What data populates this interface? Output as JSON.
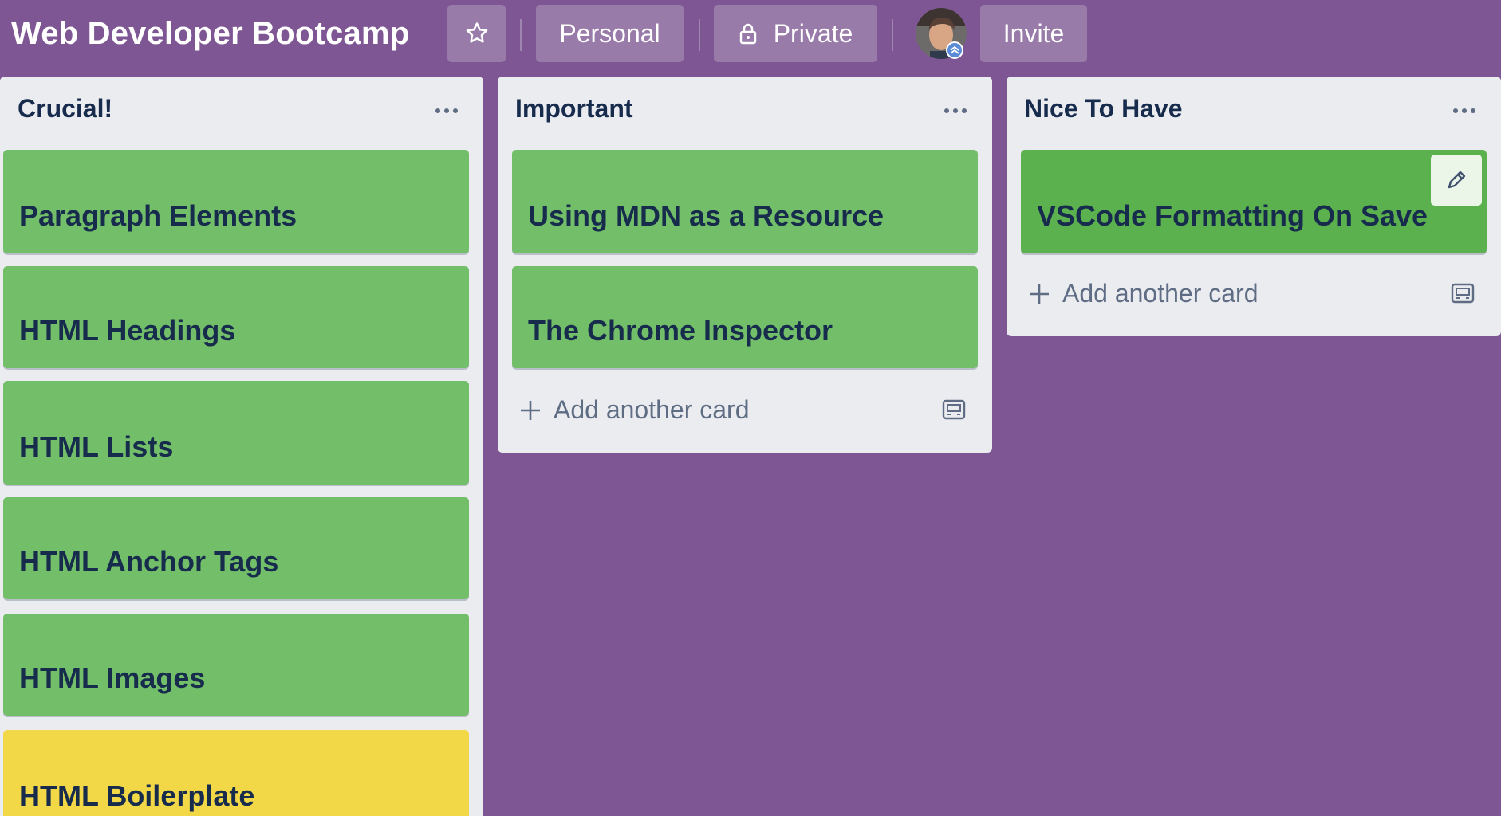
{
  "board": {
    "title": "Web Developer Bootcamp",
    "visibility_team": "Personal",
    "visibility_privacy": "Private",
    "invite_label": "Invite"
  },
  "lists": [
    {
      "title": "Crucial!",
      "cards": [
        "Paragraph Elements",
        "HTML Headings",
        "HTML Lists",
        "HTML Anchor Tags",
        "HTML Images",
        "HTML Boilerplate"
      ]
    },
    {
      "title": "Important",
      "cards": [
        "Using MDN as a Resource",
        "The Chrome Inspector"
      ],
      "add_card_label": "Add another card"
    },
    {
      "title": "Nice To Have",
      "cards": [
        "VSCode Formatting On Save"
      ],
      "add_card_label": "Add another card"
    }
  ],
  "colors": {
    "board_background": "#7d5693",
    "list_background": "#ebecf0",
    "label_green": "#73bf69",
    "label_green_hover": "#5cb14f",
    "label_yellow": "#f2d847",
    "card_text": "#172b4d"
  },
  "icons": {
    "star": "star-icon",
    "lock": "lock-icon",
    "list_menu": "more-horizontal-icon",
    "add": "plus-icon",
    "template": "card-template-icon",
    "edit": "pencil-icon"
  }
}
